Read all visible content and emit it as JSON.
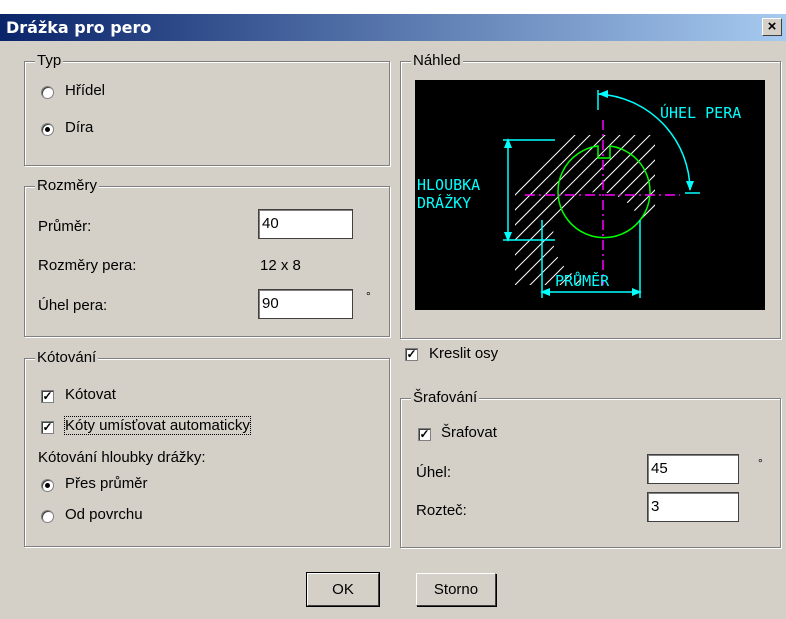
{
  "window": {
    "title": "Drážka pro pero",
    "close_glyph": "×"
  },
  "typ": {
    "legend": "Typ",
    "options": [
      {
        "label": "Hřídel",
        "selected": false
      },
      {
        "label": "Díra",
        "selected": true
      }
    ]
  },
  "rozmery": {
    "legend": "Rozměry",
    "prumer_label": "Průměr:",
    "prumer_value": "40",
    "rozmery_pera_label": "Rozměry pera:",
    "rozmery_pera_value": "12 x 8",
    "uhel_pera_label": "Úhel pera:",
    "uhel_pera_value": "90",
    "uhel_unit": "°"
  },
  "kotovani": {
    "legend": "Kótování",
    "kotovat_label": "Kótovat",
    "kotovat_checked": true,
    "auto_label": "Kóty umísťovat automaticky",
    "auto_checked": true,
    "hloubka_label": "Kótování hloubky drážky:",
    "options": [
      {
        "label": "Přes průměr",
        "selected": true
      },
      {
        "label": "Od povrchu",
        "selected": false
      }
    ]
  },
  "nahled": {
    "legend": "Náhled",
    "labels": {
      "uhel_pera": "ÚHEL PERA",
      "hloubka_1": "HLOUBKA",
      "hloubka_2": "DRÁŽKY",
      "prumer": "PRŮMĚR"
    },
    "colors": {
      "background": "#000000",
      "hatch": "#ffffff",
      "circle": "#00ff00",
      "dimension": "#00ffff",
      "axis": "#ff00ff"
    }
  },
  "kreslit_osy": {
    "label": "Kreslit osy",
    "checked": true
  },
  "srafovani": {
    "legend": "Šrafování",
    "srafovat_label": "Šrafovat",
    "srafovat_checked": true,
    "uhel_label": "Úhel:",
    "uhel_value": "45",
    "uhel_unit": "°",
    "roztec_label": "Rozteč:",
    "roztec_value": "3"
  },
  "buttons": {
    "ok": "OK",
    "storno": "Storno"
  }
}
